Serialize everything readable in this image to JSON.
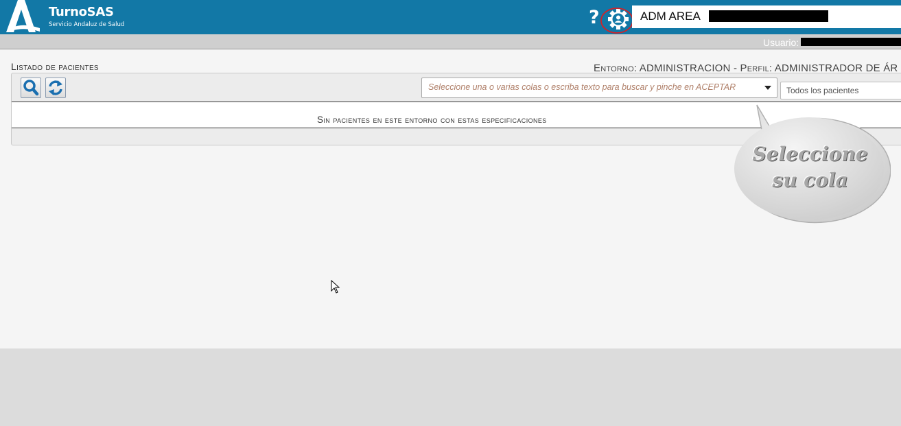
{
  "header": {
    "brand": "TurnoSAS",
    "brand_sub": "Servicio Andaluz de Salud",
    "help_icon": "question-mark",
    "settings_icon": "gear-user-icon",
    "center_label": "ADM AREA"
  },
  "subbar": {
    "user_label": "Usuario:"
  },
  "main": {
    "list_title": "Listado de pacientes",
    "environment_text": "Entorno: ADMINISTRACION - Perfil: ADMINISTRADOR DE ÁR",
    "search_icon": "magnifier",
    "refresh_icon": "refresh-arrows",
    "queue_placeholder": "Seleccione una o varias colas o escriba texto para buscar y pinche en ACEPTAR",
    "patient_filter": "Todos los pacientes",
    "empty_message": "Sin pacientes en este entorno con estas especificaciones"
  },
  "tooltip": {
    "line1": "Seleccione",
    "line2": "su cola"
  },
  "colors": {
    "header_bg": "#1278a6",
    "highlight_ring": "#d0232a",
    "accent": "#1a6fb0"
  }
}
